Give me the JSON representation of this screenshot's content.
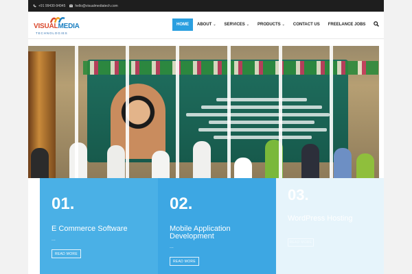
{
  "topbar": {
    "phone": "+91 99430-94945",
    "email": "hello@visualmediatech.com"
  },
  "logo": {
    "word_a": "VISUAL",
    "word_b": "MEDIA",
    "sub": "TECHNOLOGIES"
  },
  "nav": {
    "items": [
      {
        "label": "HOME",
        "active": true
      },
      {
        "label": "ABOUT",
        "dropdown": true
      },
      {
        "label": "SERVICES",
        "dropdown": true
      },
      {
        "label": "PRODUCTS",
        "dropdown": true
      },
      {
        "label": "CONTACT US"
      },
      {
        "label": "FREELANCE JOBS"
      }
    ]
  },
  "features": [
    {
      "num": "01.",
      "title": "E Commerce Software",
      "dash": "...",
      "button": "READ MORE"
    },
    {
      "num": "02.",
      "title": "Mobile Application Development",
      "dash": "...",
      "button": "READ MORE"
    },
    {
      "num": "03.",
      "title": "WordPress Hosting",
      "button": "READ MORE"
    }
  ],
  "colors": {
    "accent": "#2a9fe0",
    "feature1": "#4ab0e6",
    "feature2": "#3da7e3",
    "feature3": "#e6f4fb",
    "topbar": "#1e1e1e"
  }
}
